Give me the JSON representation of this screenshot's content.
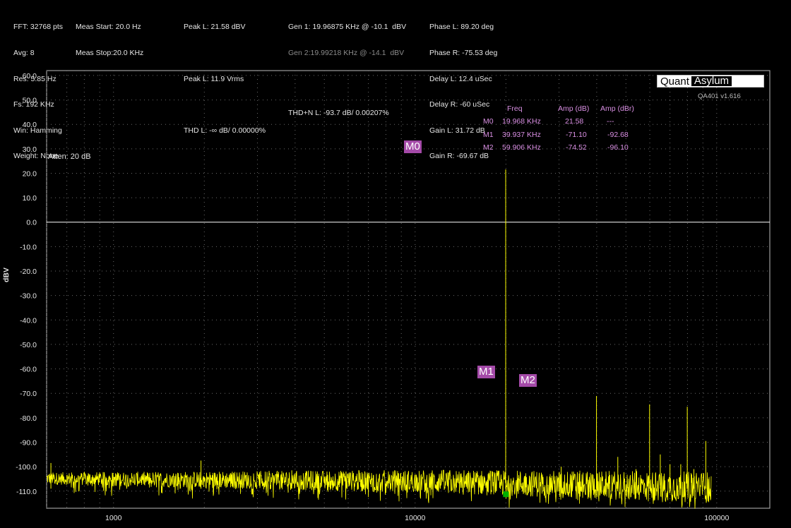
{
  "header": {
    "col1": [
      "FFT: 32768 pts",
      "Avg: 8",
      "Res: 5.85 Hz",
      "Fs: 192 KHz",
      "Win: Hamming",
      "Weight: None"
    ],
    "col2": [
      "Meas Start: 20.0 Hz",
      "Meas Stop:20.0 KHz"
    ],
    "col3": [
      "Peak L: 21.58 dBV",
      "",
      "Peak L: 11.9 Vrms",
      "",
      "THD L: -∞ dB/ 0.00000%"
    ],
    "gen1": "Gen 1: 19.96875 KHz @ -10.1  dBV",
    "gen2": "Gen 2:19.99218 KHz @ -14.1  dBV",
    "thdn": "THD+N L: -93.7 dB/ 0.00207%",
    "col5": [
      "Phase L: 89.20 deg",
      "Phase R: -75.53 deg",
      "Delay L: 12.4 uSec",
      "Delay R: -60 uSec",
      "Gain L: 31.72 dB",
      "Gain R: -69.67 dB"
    ]
  },
  "logo": {
    "part1": "Quant",
    "part2": "Asylum"
  },
  "version": "QA401 v1.616",
  "atten": "Atten: 20 dB",
  "markers_table": {
    "headers": [
      "Freq",
      "Amp (dB)",
      "Amp (dBr)"
    ],
    "rows": [
      {
        "id": "M0",
        "freq": "19.968 KHz",
        "amp": "21.58",
        "ampr": "---"
      },
      {
        "id": "M1",
        "freq": "39.937 KHz",
        "amp": "-71.10",
        "ampr": "-92.68"
      },
      {
        "id": "M2",
        "freq": "59.906 KHz",
        "amp": "-74.52",
        "ampr": "-96.10"
      }
    ]
  },
  "marker_labels": [
    "M0",
    "M1",
    "M2"
  ],
  "colors": {
    "trace": "#ffff00",
    "marker_bg": "#a44aa8",
    "marker_text": "#d98fe3",
    "grid": "#6a6a6a",
    "zero_line": "#ffffff",
    "background": "#000000"
  },
  "chart_data": {
    "type": "line",
    "xscale": "log",
    "xlim": [
      600,
      150000
    ],
    "ylim": [
      -117,
      62
    ],
    "ylabel": "dBV",
    "xlabel": "",
    "grid": true,
    "x_ticks": [
      1000,
      10000,
      100000
    ],
    "x_tick_labels": [
      "1000",
      "10000",
      "100000"
    ],
    "y_ticks": [
      60,
      50,
      40,
      30,
      20,
      10,
      0,
      -10,
      -20,
      -30,
      -40,
      -50,
      -60,
      -70,
      -80,
      -90,
      -100,
      -110
    ],
    "y_tick_labels": [
      "60.0",
      "50.0",
      "40.0",
      "30.0",
      "20.0",
      "10.0",
      "0.0",
      "-10.0",
      "-20.0",
      "-30.0",
      "-40.0",
      "-50.0",
      "-60.0",
      "-70.0",
      "-80.0",
      "-90.0",
      "-100.0",
      "-110.0"
    ],
    "noise_floor_db": -107,
    "noise_end_hz": 96000,
    "peaks": [
      {
        "x": 19968,
        "y": 21.58
      },
      {
        "x": 39937,
        "y": -71.1
      },
      {
        "x": 59906,
        "y": -74.52
      },
      {
        "x": 79875,
        "y": -75.5
      },
      {
        "x": 92000,
        "y": -89.5
      },
      {
        "x": 30500,
        "y": -100
      },
      {
        "x": 47000,
        "y": -96
      },
      {
        "x": 54000,
        "y": -101
      },
      {
        "x": 65000,
        "y": -95
      },
      {
        "x": 70000,
        "y": -99
      },
      {
        "x": 76000,
        "y": -99
      },
      {
        "x": 84000,
        "y": -101
      },
      {
        "x": 620,
        "y": -98.5
      },
      {
        "x": 1950,
        "y": -97.5
      },
      {
        "x": 3900,
        "y": -101.5
      },
      {
        "x": 5900,
        "y": -102
      },
      {
        "x": 10000,
        "y": -103.5
      },
      {
        "x": 15000,
        "y": -102.5
      }
    ],
    "markers": [
      {
        "name": "M0",
        "x": 19968,
        "y": 21.58
      },
      {
        "name": "M1",
        "x": 39937,
        "y": -71.1
      },
      {
        "name": "M2",
        "x": 59906,
        "y": -74.52
      }
    ],
    "cursor": {
      "x": 20000,
      "y": -111.3,
      "color": "#00b000"
    }
  }
}
